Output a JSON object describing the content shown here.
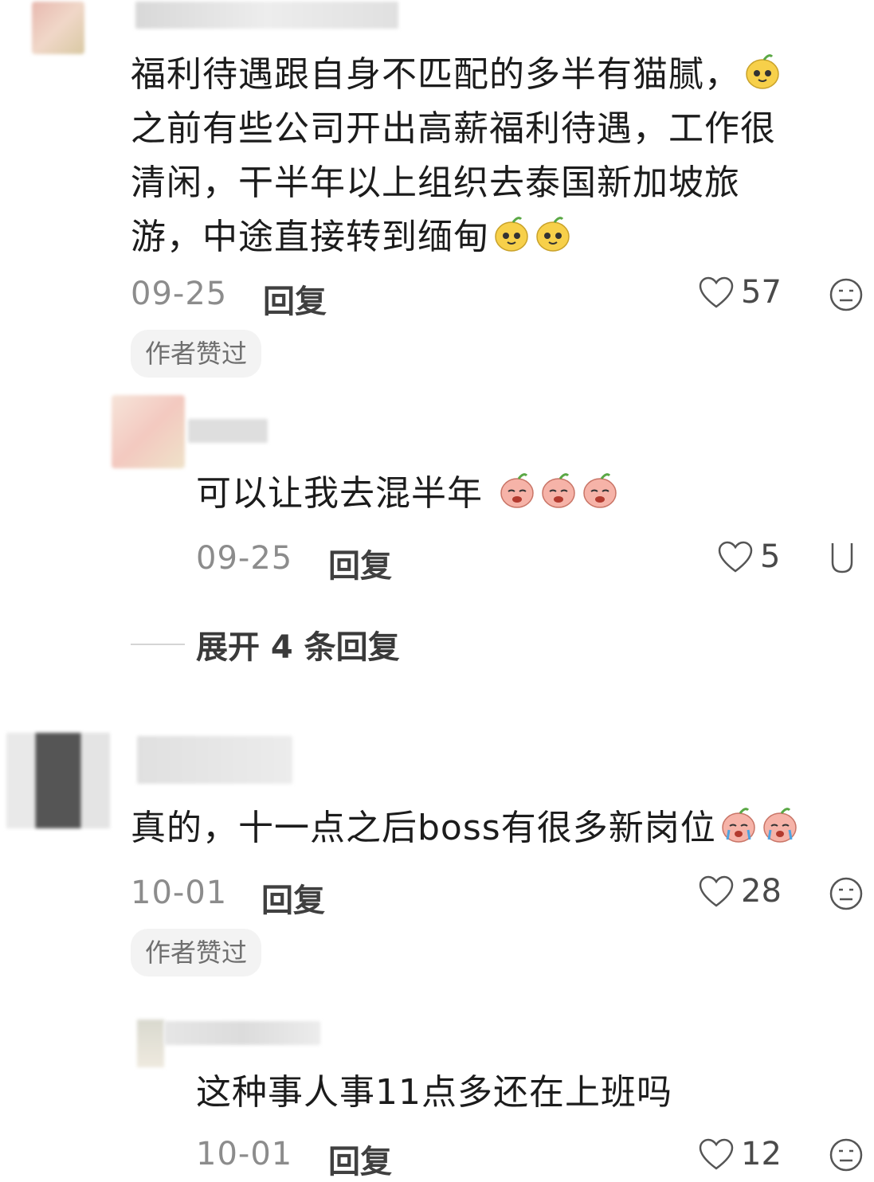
{
  "comments": [
    {
      "text": "福利待遇跟自身不匹配的多半有猫腻，之前有些公司开出高薪福利待遇，工作很清闲，干半年以上组织去泰国新加坡旅游，中途直接转到缅甸",
      "lines": [
        "福利待遇跟自身不匹配的多半有猫腻，",
        "之前有些公司开出高薪福利待遇，工作很",
        "清闲，干半年以上组织去泰国新加坡旅",
        "游，中途直接转到缅甸"
      ],
      "date": "09-25",
      "reply_label": "回复",
      "likes": "57",
      "badge": "作者赞过"
    },
    {
      "text": "可以让我去混半年",
      "date": "09-25",
      "reply_label": "回复",
      "likes": "5"
    },
    {
      "text": "真的，十一点之后boss有很多新岗位",
      "date": "10-01",
      "reply_label": "回复",
      "likes": "28",
      "badge": "作者赞过"
    },
    {
      "text": "这种事人事11点多还在上班吗",
      "date": "10-01",
      "reply_label": "回复",
      "likes": "12"
    }
  ],
  "expand_replies": "展开 4 条回复",
  "icons": {
    "like": "heart-outline-icon",
    "dislike": "meh-face-icon",
    "emoji_sweat": "yellow-sweat-emoji",
    "emoji_cry": "crying-pink-emoji"
  },
  "colors": {
    "text": "#1c1c1c",
    "meta": "#8c8c8c",
    "badge_bg": "#f3f3f3"
  }
}
